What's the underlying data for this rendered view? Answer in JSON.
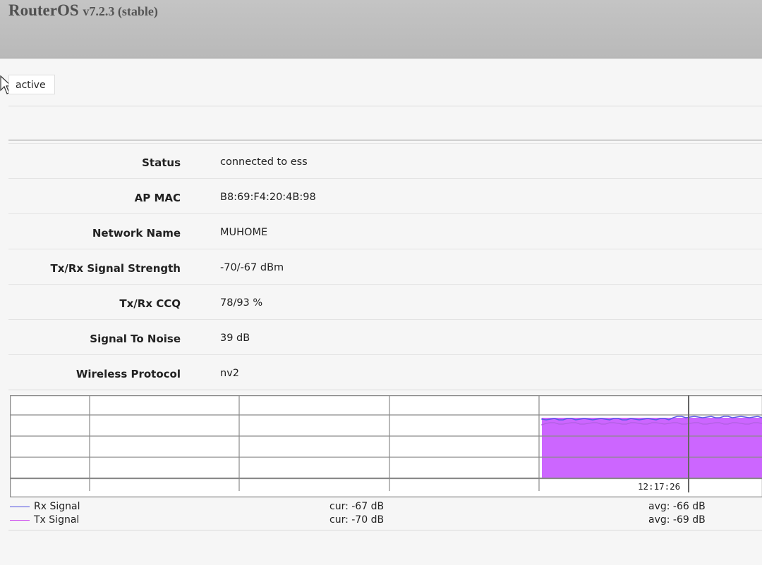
{
  "header": {
    "brand": "RouterOS",
    "version": "v7.2.3 (stable)"
  },
  "tab": {
    "label": "active"
  },
  "details": [
    {
      "label": "Status",
      "value": "connected to ess"
    },
    {
      "label": "AP MAC",
      "value": "B8:69:F4:20:4B:98"
    },
    {
      "label": "Network Name",
      "value": "MUHOME"
    },
    {
      "label": "Tx/Rx Signal Strength",
      "value": "-70/-67 dBm"
    },
    {
      "label": "Tx/Rx CCQ",
      "value": "78/93 %"
    },
    {
      "label": "Signal To Noise",
      "value": "39 dB"
    },
    {
      "label": "Wireless Protocol",
      "value": "nv2"
    }
  ],
  "graph": {
    "time_label": "12:17:26",
    "colors": {
      "rx": "#5a5ae6",
      "tx": "#cc66ff",
      "grid": "#8a8a8a",
      "marker": "#666666"
    }
  },
  "legend": [
    {
      "name": "Rx Signal",
      "cur": "cur: -67 dB",
      "avg": "avg: -66 dB",
      "color": "#4a4ae0"
    },
    {
      "name": "Tx Signal",
      "cur": "cur: -70 dB",
      "avg": "avg: -69 dB",
      "color": "#cc44ee"
    }
  ]
}
